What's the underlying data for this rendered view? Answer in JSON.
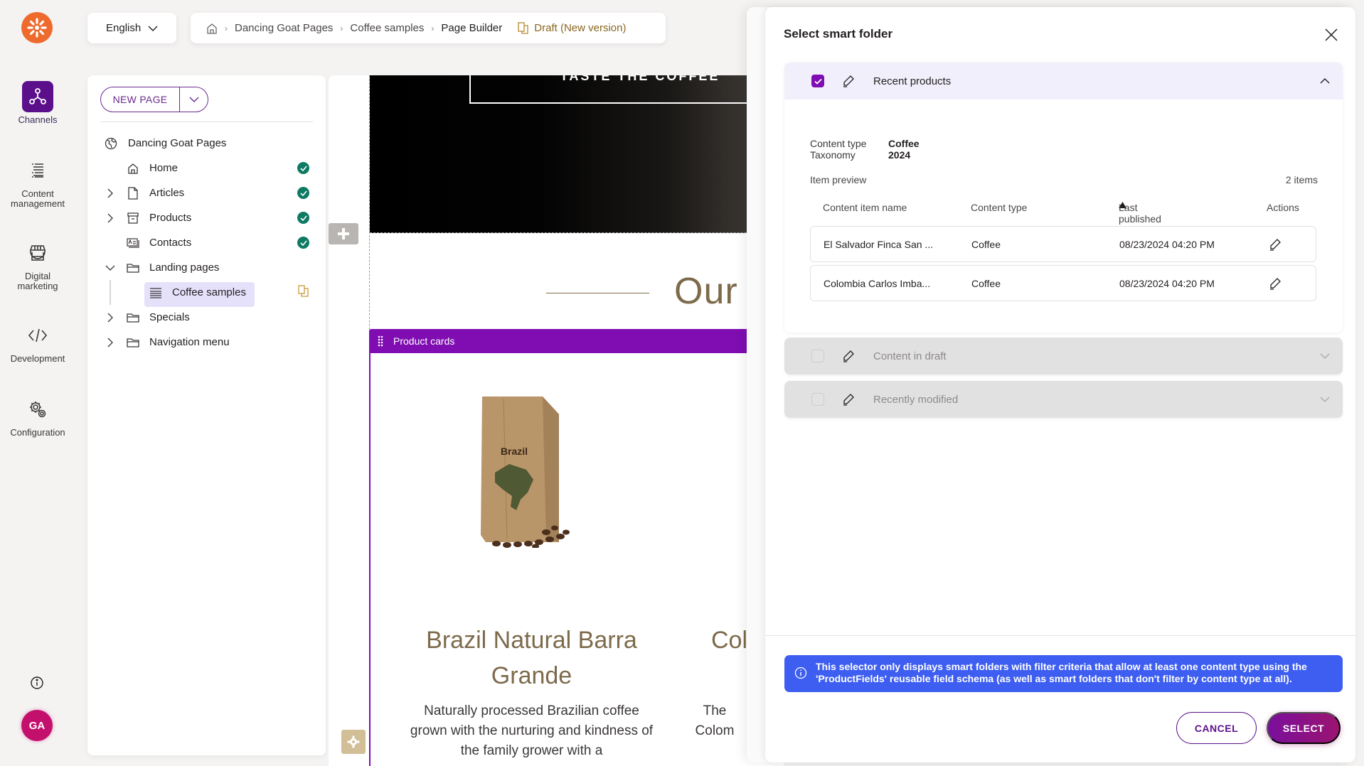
{
  "rail": {
    "items": [
      {
        "label": "Channels",
        "icon": "channels-icon",
        "active": true
      },
      {
        "label": "Content management",
        "icon": "content-management-icon",
        "active": false
      },
      {
        "label": "Digital marketing",
        "icon": "storefront-icon",
        "active": false
      },
      {
        "label": "Development",
        "icon": "code-icon",
        "active": false
      },
      {
        "label": "Configuration",
        "icon": "gears-icon",
        "active": false
      }
    ],
    "avatar_initials": "GA",
    "brand_color": "#ee6a2d",
    "active_color": "#5c0f8b",
    "avatar_color": "#c4106d"
  },
  "topbar": {
    "language": "English",
    "breadcrumb": [
      "Dancing Goat Pages",
      "Coffee samples",
      "Page Builder"
    ],
    "status": "Draft (New version)"
  },
  "tree": {
    "new_page_label": "NEW PAGE",
    "root": "Dancing Goat Pages",
    "nodes": [
      {
        "label": "Home",
        "icon": "home-icon",
        "expandable": false,
        "status": "published"
      },
      {
        "label": "Articles",
        "icon": "page-icon",
        "expandable": true,
        "status": "published"
      },
      {
        "label": "Products",
        "icon": "archive-icon",
        "expandable": true,
        "status": "published"
      },
      {
        "label": "Contacts",
        "icon": "contact-card-icon",
        "expandable": false,
        "status": "published"
      },
      {
        "label": "Landing pages",
        "icon": "folder-icon",
        "expandable": true,
        "expanded": true,
        "status": ""
      },
      {
        "label": "Coffee samples",
        "icon": "layout-icon",
        "expandable": false,
        "selected": true,
        "status": "draft"
      },
      {
        "label": "Specials",
        "icon": "folder-icon",
        "expandable": true,
        "status": ""
      },
      {
        "label": "Navigation menu",
        "icon": "folder-icon",
        "expandable": true,
        "status": ""
      }
    ]
  },
  "canvas": {
    "hero_button": "TASTE THE COFFEE",
    "section_heading": "Our l",
    "widget_label": "Product cards",
    "bag_label": "Brazil",
    "product1_title": "Brazil Natural Barra Grande",
    "product1_desc": "Naturally processed Brazilian coffee grown with the nurturing and kindness of the family grower with a",
    "product2_title": "Col",
    "product2_desc": "The Colom quality c"
  },
  "dialog": {
    "title": "Select smart folder",
    "folders": [
      {
        "label": "Recent products",
        "checked": true,
        "expanded": true,
        "content_type_label": "Content type",
        "content_type_value": "Coffee",
        "taxonomy_label": "Taxonomy",
        "taxonomy_value": "2024",
        "item_preview_label": "Item preview",
        "item_count": "2 items",
        "columns": [
          "Content item name",
          "Content type",
          "Last published",
          "Actions"
        ],
        "sort_column": "Last published",
        "sort_direction": "ascending",
        "rows": [
          {
            "name": "El Salvador Finca San ...",
            "type": "Coffee",
            "published": "08/23/2024 04:20 PM"
          },
          {
            "name": "Colombia Carlos Imba...",
            "type": "Coffee",
            "published": "08/23/2024 04:20 PM"
          }
        ]
      },
      {
        "label": "Content in draft",
        "checked": false,
        "expanded": false
      },
      {
        "label": "Recently modified",
        "checked": false,
        "expanded": false
      }
    ],
    "info": "This selector only displays smart folders with filter criteria that allow at least one content type using the 'ProductFields' reusable field schema (as well as smart folders that don't filter by content type at all).",
    "cancel_label": "CANCEL",
    "select_label": "SELECT",
    "accent_color": "#7f0db1",
    "info_color": "#3d5ef1"
  }
}
